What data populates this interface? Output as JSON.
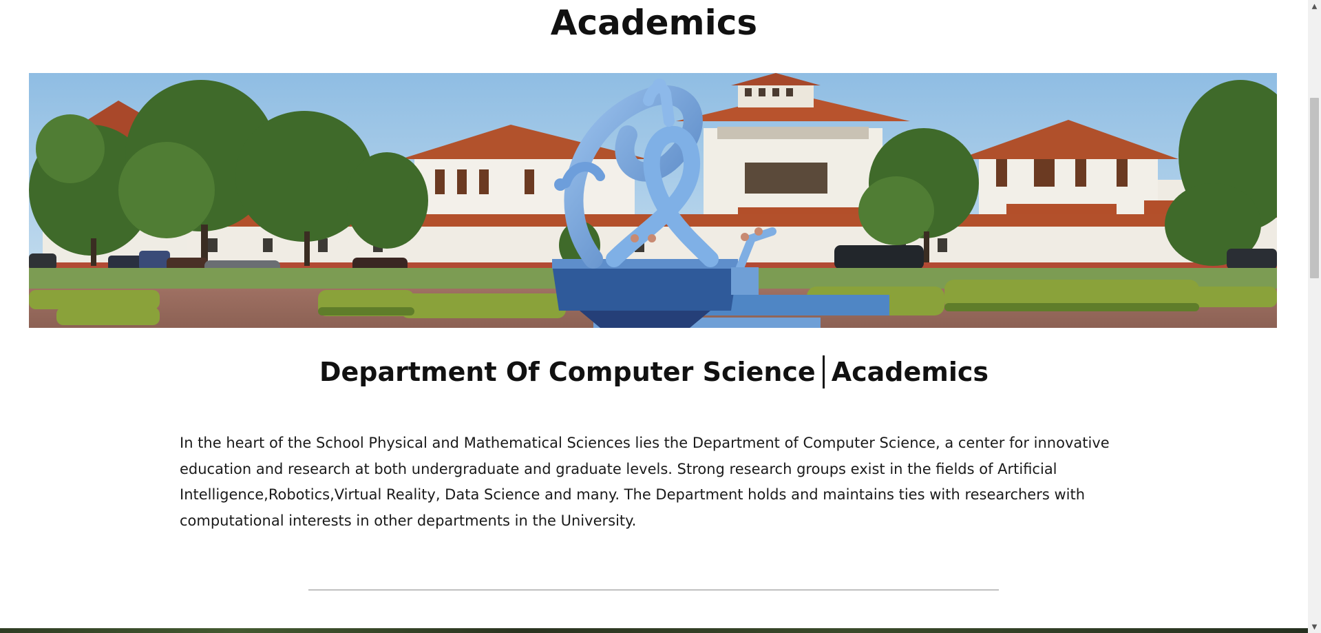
{
  "page": {
    "title": "Academics"
  },
  "hero": {
    "alt": "Campus building with blue sculpture and fountain"
  },
  "department": {
    "name": "Department Of Computer Science",
    "section": "Academics"
  },
  "intro": {
    "text": "In the heart of the School Physical and Mathematical Sciences lies the Department of Computer Science, a center for innovative education and research at both undergraduate and graduate levels. Strong research groups exist in the fields of Artificial Intelligence,Robotics,Virtual Reality, Data Science and many. The Department holds and maintains ties with researchers with computational interests in other departments in the University."
  },
  "scrollbar": {
    "up_glyph": "▲",
    "down_glyph": "▼"
  },
  "colors": {
    "sky": "#a9cde8",
    "roof": "#b8532d",
    "wall": "#f2efe8",
    "sculpture": "#6f9fd6",
    "foliage": "#3f6a2a"
  }
}
